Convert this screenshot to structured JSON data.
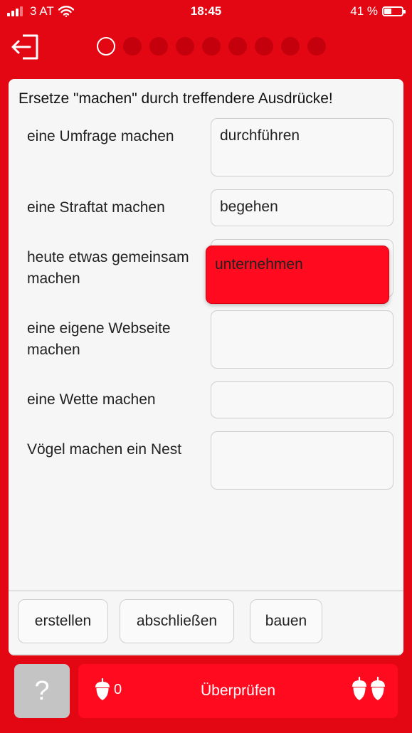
{
  "status_bar": {
    "carrier": "3 AT",
    "time": "18:45",
    "battery_percent": "41 %",
    "battery_level": 0.41
  },
  "progress": {
    "total": 9,
    "current": 1
  },
  "instruction": "Ersetze \"machen\" durch treffendere Ausdrücke!",
  "rows": [
    {
      "label": "eine Umfrage machen",
      "answer": "durchführen"
    },
    {
      "label": "eine Straftat machen",
      "answer": "begehen"
    },
    {
      "label": "heute etwas gemeinsam machen",
      "answer": ""
    },
    {
      "label": "eine eigene Webseite machen",
      "answer": ""
    },
    {
      "label": "eine Wette machen",
      "answer": ""
    },
    {
      "label": "Vögel machen ein Nest",
      "answer": ""
    }
  ],
  "dragging_word": "unternehmen",
  "word_bank": [
    "erstellen",
    "abschließen",
    "bauen"
  ],
  "bottom_bar": {
    "help_label": "?",
    "check_label": "Überprüfen",
    "acorn_count": "0"
  },
  "colors": {
    "brand_red": "#e30613",
    "button_red": "#ff0a1e",
    "dot_inactive": "#c4000c",
    "help_grey": "#c4c4c4"
  }
}
